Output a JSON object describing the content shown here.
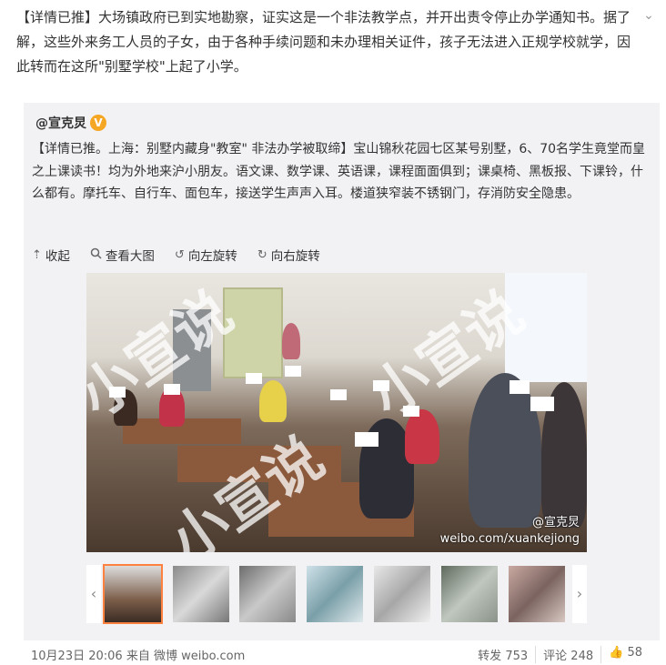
{
  "post": {
    "text_lead": "【详情已推】",
    "text_body": "大场镇政府已到实地勘察，证实这是一个非法教学点，并开出责令停止办学通知书。据了解，这些外来务工人员的子女，由于各种手续问题和未办理相关证件，孩子无法进入正规学校就学，因此转而在这所\"别墅学校\"上起了小学。"
  },
  "repost": {
    "author": "@宣克炅",
    "text": "【详情已推。上海：别墅内藏身\"教室\" 非法办学被取缔】宝山锦秋花园七区某号别墅，6、70名学生竟堂而皇之上课读书！均为外地来沪小朋友。语文课、数学课、英语课，课程面面俱到；课桌椅、黑板报、下课铃，什么都有。摩托车、自行车、面包车，接送学生声声入耳。楼道狭窄装不锈钢门，存消防安全隐患。",
    "tools": {
      "collapse": "收起",
      "view_large": "查看大图",
      "rotate_left": "向左旋转",
      "rotate_right": "向右旋转"
    },
    "photo_watermark_1": "小宣说",
    "photo_credit_handle": "@宣克炅",
    "photo_credit_url": "weibo.com/xuankejiong",
    "thumb_count": 7
  },
  "footer": {
    "time": "10月23日 20:06",
    "from_label": "来自",
    "source": "微博 weibo.com",
    "repost_label": "转发",
    "repost_count": "753",
    "comment_label": "评论",
    "comment_count": "248",
    "like_count": "58"
  },
  "colors": {
    "accent": "#ff8140",
    "repost_bg": "#f2f2f5",
    "vbadge": "#f5a623"
  }
}
